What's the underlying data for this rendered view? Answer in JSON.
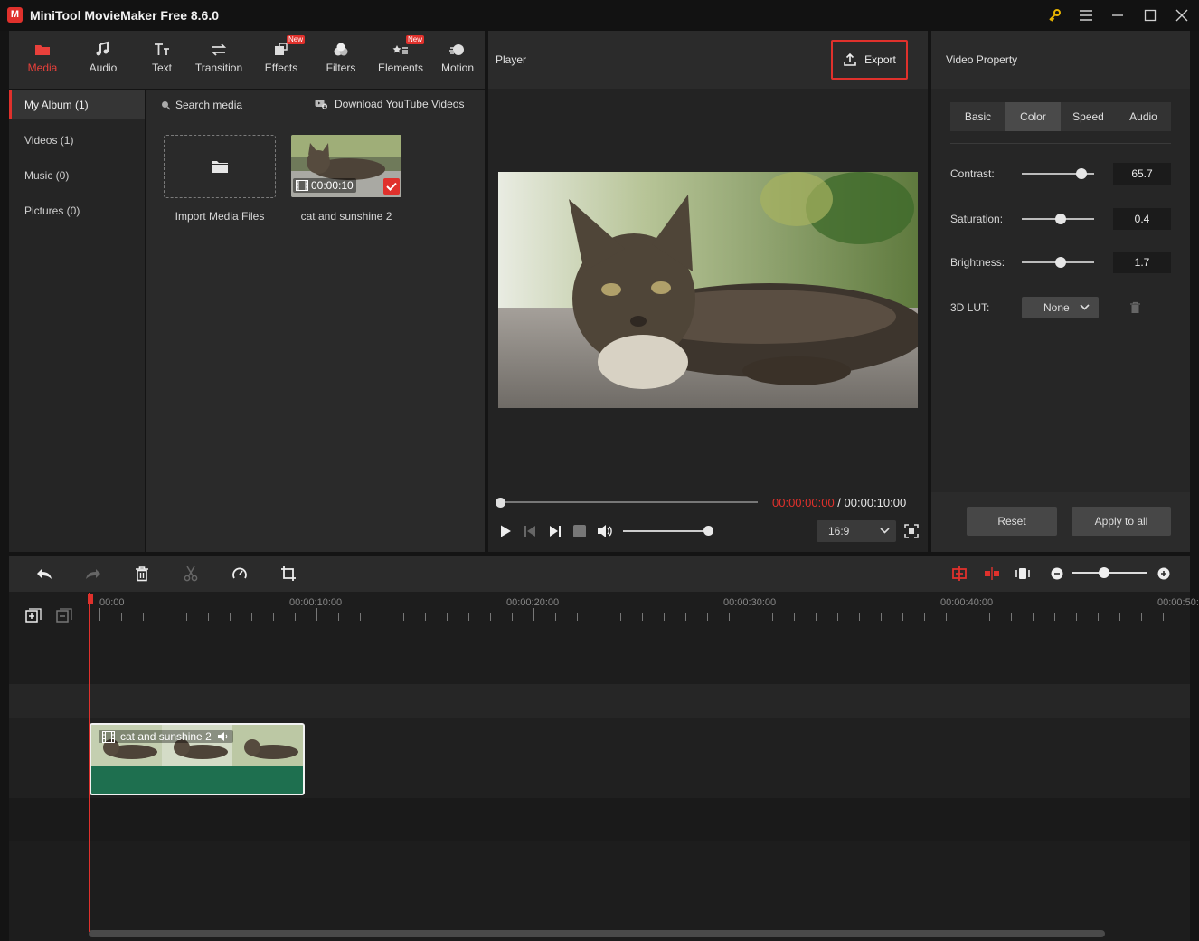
{
  "app": {
    "title": "MiniTool MovieMaker Free 8.6.0",
    "logo_letter": "M",
    "accent": "#e0312c"
  },
  "toolbar": {
    "items": [
      {
        "label": "Media",
        "icon": "folder-icon",
        "active": true
      },
      {
        "label": "Audio",
        "icon": "music-note-icon"
      },
      {
        "label": "Text",
        "icon": "text-icon"
      },
      {
        "label": "Transition",
        "icon": "transition-arrows-icon"
      },
      {
        "label": "Effects",
        "icon": "effects-icon",
        "badge": "New"
      },
      {
        "label": "Filters",
        "icon": "filters-icon"
      },
      {
        "label": "Elements",
        "icon": "elements-icon",
        "badge": "New"
      },
      {
        "label": "Motion",
        "icon": "motion-icon"
      }
    ]
  },
  "albums": {
    "items": [
      {
        "label": "My Album (1)"
      },
      {
        "label": "Videos (1)"
      },
      {
        "label": "Music (0)"
      },
      {
        "label": "Pictures (0)"
      }
    ]
  },
  "media": {
    "search_placeholder": "Search media",
    "download_label": "Download YouTube Videos",
    "import_label": "Import Media Files",
    "clip": {
      "name": "cat and sunshine 2",
      "duration": "00:00:10"
    }
  },
  "player": {
    "title": "Player",
    "export_label": "Export",
    "current_time": "00:00:00:00",
    "time_separator": " / ",
    "total_time": "00:00:10:00",
    "progress": 0,
    "volume": 1.0,
    "aspect": "16:9"
  },
  "property": {
    "title": "Video Property",
    "tabs": [
      {
        "label": "Basic"
      },
      {
        "label": "Color",
        "active": true
      },
      {
        "label": "Speed"
      },
      {
        "label": "Audio"
      }
    ],
    "contrast": {
      "label": "Contrast:",
      "value": "65.7",
      "level": 0.82
    },
    "saturation": {
      "label": "Saturation:",
      "value": "0.4",
      "level": 0.54
    },
    "brightness": {
      "label": "Brightness:",
      "value": "1.7",
      "level": 0.54
    },
    "lut": {
      "label": "3D LUT:",
      "value": "None"
    },
    "reset_label": "Reset",
    "apply_label": "Apply to all"
  },
  "timeline": {
    "ticks": [
      "00:00",
      "00:00:10:00",
      "00:00:20:00",
      "00:00:30:00",
      "00:00:40:00",
      "00:00:50:"
    ],
    "clip_label": "cat and sunshine 2",
    "zoom_level": 0.42
  }
}
